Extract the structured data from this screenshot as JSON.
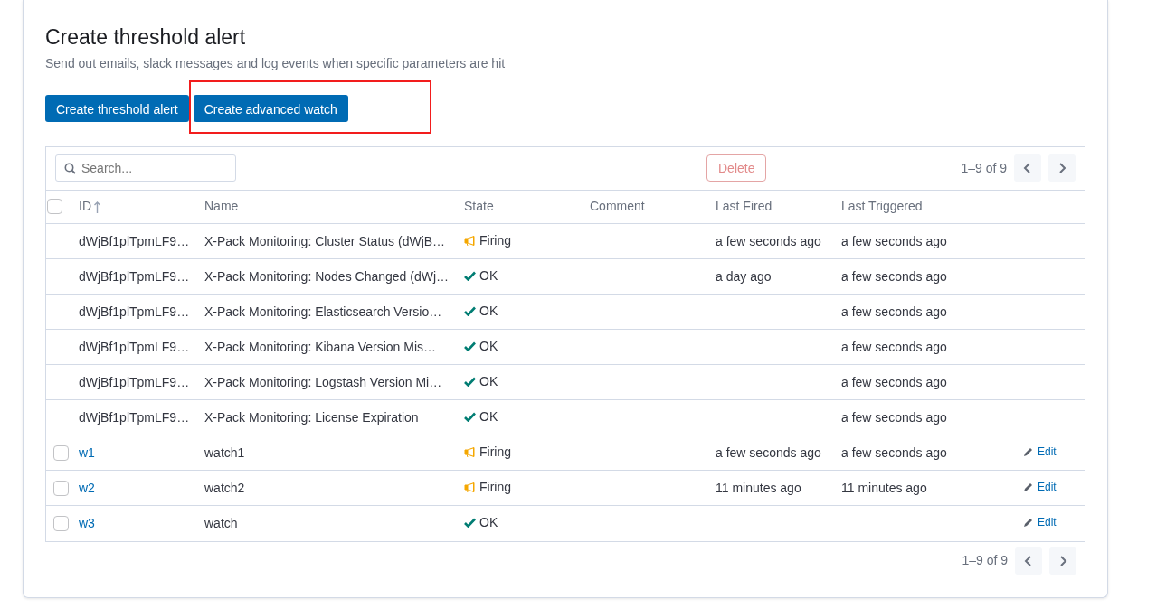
{
  "header": {
    "title": "Create threshold alert",
    "subtitle": "Send out emails, slack messages and log events when specific parameters are hit"
  },
  "buttons": [
    {
      "label": "Create threshold alert",
      "highlighted": false
    },
    {
      "label": "Create advanced watch",
      "highlighted": true
    }
  ],
  "toolbar": {
    "search": {
      "placeholder": "Search..."
    },
    "delete_button": {
      "label": "Delete",
      "disabled": true
    },
    "pagination": "1–9 of 9"
  },
  "table": {
    "select_all": {
      "checked": false
    },
    "columns": [
      {
        "label": "ID",
        "sorted": true
      },
      {
        "label": "Name",
        "sorted": false
      },
      {
        "label": "State",
        "sorted": false
      },
      {
        "label": "Comment",
        "sorted": false
      },
      {
        "label": "Last Fired",
        "sorted": false
      },
      {
        "label": "Last Triggered",
        "sorted": false
      }
    ],
    "rows": [
      {
        "selectable": false,
        "id": "dWjBf1plTpmLF9…",
        "name": "X-Pack Monitoring: Cluster Status (dWjB…",
        "state": {
          "kind": "firing",
          "label": "Firing"
        },
        "last_fired": "a few seconds ago",
        "last_triggered": "a few seconds ago"
      },
      {
        "selectable": false,
        "id": "dWjBf1plTpmLF9…",
        "name": "X-Pack Monitoring: Nodes Changed (dWj…",
        "state": {
          "kind": "ok",
          "label": "OK"
        },
        "last_fired": "a day ago",
        "last_triggered": "a few seconds ago"
      },
      {
        "selectable": false,
        "id": "dWjBf1plTpmLF9…",
        "name": "X-Pack Monitoring: Elasticsearch Versio…",
        "state": {
          "kind": "ok",
          "label": "OK"
        },
        "last_triggered": "a few seconds ago"
      },
      {
        "selectable": false,
        "id": "dWjBf1plTpmLF9…",
        "name": "X-Pack Monitoring: Kibana Version Mis…",
        "state": {
          "kind": "ok",
          "label": "OK"
        },
        "last_triggered": "a few seconds ago"
      },
      {
        "selectable": false,
        "id": "dWjBf1plTpmLF9…",
        "name": "X-Pack Monitoring: Logstash Version Mi…",
        "state": {
          "kind": "ok",
          "label": "OK"
        },
        "last_triggered": "a few seconds ago"
      },
      {
        "selectable": false,
        "id": "dWjBf1plTpmLF9…",
        "name": "X-Pack Monitoring: License Expiration",
        "state": {
          "kind": "ok",
          "label": "OK"
        },
        "last_triggered": "a few seconds ago"
      },
      {
        "selectable": true,
        "checked": false,
        "id": "w1",
        "name": "watch1",
        "state": {
          "kind": "firing",
          "label": "Firing"
        },
        "last_fired": "a few seconds ago",
        "last_triggered": "a few seconds ago",
        "action": "Edit"
      },
      {
        "selectable": true,
        "checked": false,
        "id": "w2",
        "name": "watch2",
        "state": {
          "kind": "firing",
          "label": "Firing"
        },
        "last_fired": "11 minutes ago",
        "last_triggered": "11 minutes ago",
        "action": "Edit"
      },
      {
        "selectable": true,
        "checked": false,
        "id": "w3",
        "name": "watch",
        "state": {
          "kind": "ok",
          "label": "OK"
        },
        "action": "Edit"
      }
    ]
  },
  "footer": {
    "pagination": "1–9 of 9"
  }
}
